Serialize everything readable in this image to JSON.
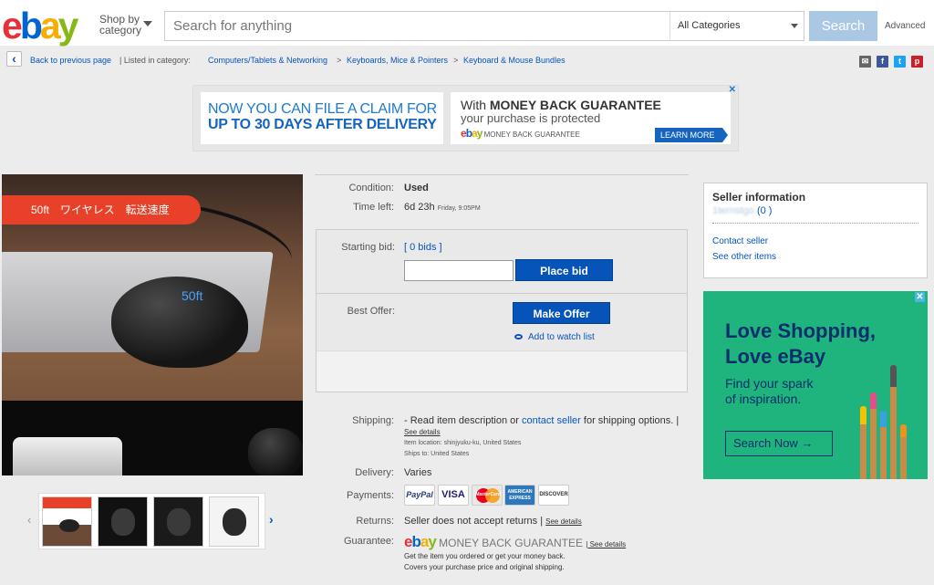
{
  "header": {
    "shop_by_line1": "Shop by",
    "shop_by_line2": "category",
    "search_placeholder": "Search for anything",
    "category": "All Categories",
    "search_button": "Search",
    "advanced": "Advanced"
  },
  "breadcrumb": {
    "back": "Back to previous page",
    "listed_in": "| Listed in category:",
    "items": [
      "Computers/Tablets & Networking",
      "Keyboards, Mice & Pointers",
      "Keyboard & Mouse Bundles"
    ],
    "sep": ">"
  },
  "banner": {
    "left_line1": "NOW YOU CAN FILE A CLAIM FOR",
    "left_line2": "UP TO 30 DAYS AFTER DELIVERY",
    "right_title_prefix": "With",
    "right_title_bold": "MONEY BACK GUARANTEE",
    "right_sub": "your purchase is protected",
    "right_logo_text": "MONEY BACK GUARANTEE",
    "learn_more": "LEARN MORE"
  },
  "image": {
    "tag": "50ft　ワイヤレス　転送速度",
    "bottom_text": "50ft"
  },
  "item": {
    "condition_label": "Condition:",
    "condition_value": "Used",
    "time_left_label": "Time left:",
    "time_left_value": "6d 23h",
    "time_left_end": "Friday, 9:05PM",
    "starting_bid_label": "Starting bid:",
    "bids": "[ 0 bids ]",
    "place_bid": "Place bid",
    "best_offer_label": "Best Offer:",
    "make_offer": "Make Offer",
    "watch_list": "Add to watch list"
  },
  "shipping": {
    "label": "Shipping:",
    "text_pre": "- Read item description or",
    "contact_seller": "contact seller",
    "text_post": "for shipping options. |",
    "see_details": "See details",
    "item_location": "Item location:  shinjyuku-ku, United States",
    "ships_to": "Ships to:  United States"
  },
  "delivery": {
    "label": "Delivery:",
    "value": "Varies"
  },
  "payments": {
    "label": "Payments:",
    "methods": [
      "PayPal",
      "VISA",
      "MasterCard",
      "AMERICAN EXPRESS",
      "DISCOVER"
    ]
  },
  "returns": {
    "label": "Returns:",
    "value": "Seller does not accept returns |",
    "see_details": "See details"
  },
  "guarantee": {
    "label": "Guarantee:",
    "logo_text": "MONEY BACK GUARANTEE",
    "see_details": "| See details",
    "line1": "Get the item you ordered or get your money back.",
    "line2": "Covers your purchase price and original shipping."
  },
  "seller": {
    "title": "Seller information",
    "name": "1ternstgo",
    "feedback": "(0 )",
    "contact": "Contact seller",
    "other_items": "See other items"
  },
  "ad": {
    "headline1": "Love Shopping,",
    "headline2": "Love eBay",
    "sub1": "Find your spark",
    "sub2": "of inspiration.",
    "button": "Search Now"
  },
  "colors": {
    "ebay_red": "#e53238",
    "ebay_blue": "#0064d2",
    "ebay_yellow": "#f5af02",
    "ebay_green": "#86b817",
    "link_blue": "#0654ba",
    "ad_green": "#1fb47e"
  }
}
